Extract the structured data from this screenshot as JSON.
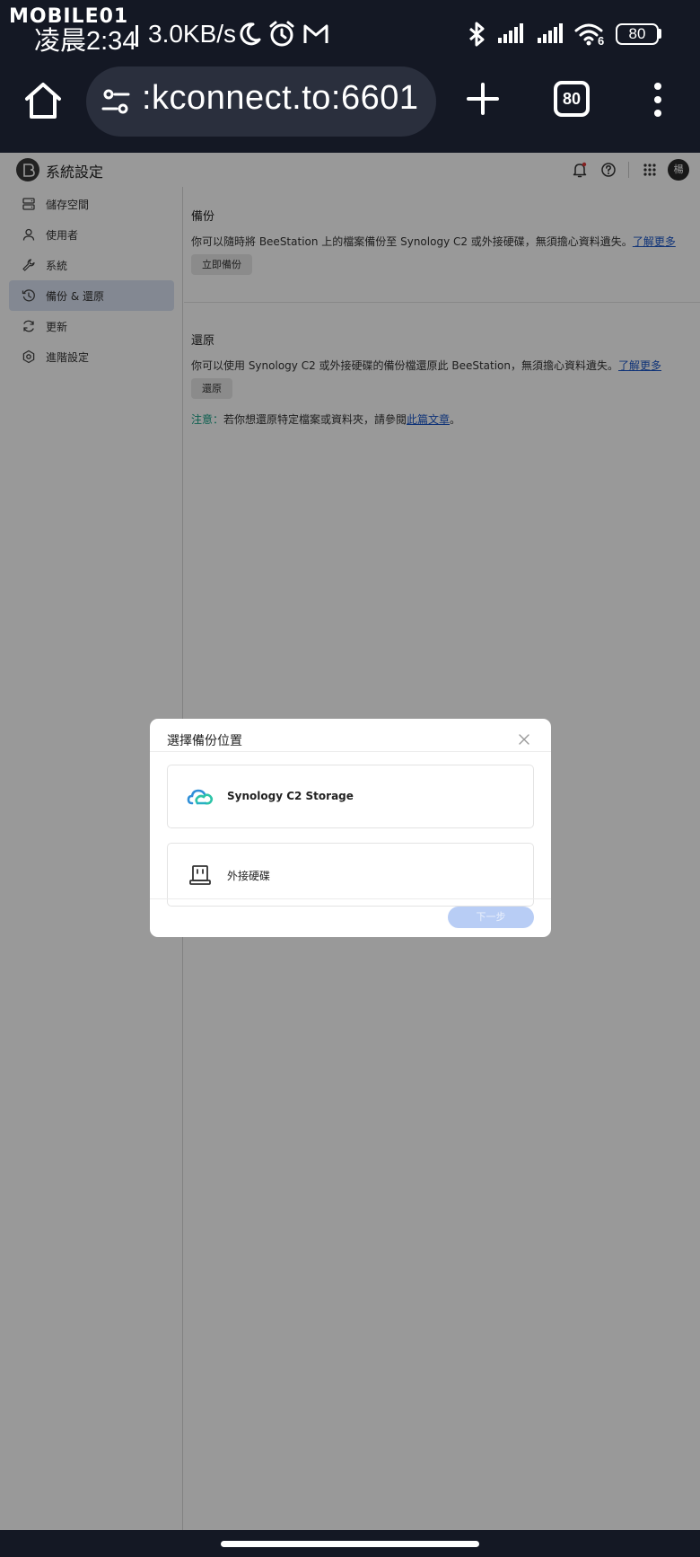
{
  "status_bar": {
    "watermark": "MOBILE01",
    "time": "凌晨2:34",
    "net_speed": "3.0KB/s",
    "battery": "80",
    "wifi_sub": "6",
    "icons": [
      "moon-icon",
      "alarm-icon",
      "gmail-icon",
      "bluetooth-icon",
      "signal-icon",
      "signal-icon",
      "wifi-icon",
      "battery-icon"
    ]
  },
  "browser": {
    "url": ":kconnect.to:6601",
    "tab_count": "80",
    "icons": [
      "home-icon",
      "site-settings-icon",
      "new-tab-icon",
      "tabs-icon",
      "more-menu-icon"
    ]
  },
  "app": {
    "title": "系統設定",
    "avatar": "楊",
    "header_icons": [
      "notification-icon",
      "help-icon",
      "apps-grid-icon"
    ]
  },
  "sidebar": {
    "items": [
      {
        "label": "儲存空間",
        "icon": "storage-icon",
        "active": false
      },
      {
        "label": "使用者",
        "icon": "user-icon",
        "active": false
      },
      {
        "label": "系統",
        "icon": "wrench-icon",
        "active": false
      },
      {
        "label": "備份 & 還原",
        "icon": "backup-restore-icon",
        "active": true
      },
      {
        "label": "更新",
        "icon": "update-icon",
        "active": false
      },
      {
        "label": "進階設定",
        "icon": "advanced-settings-icon",
        "active": false
      }
    ]
  },
  "backup": {
    "title": "備份",
    "desc": "你可以隨時將 BeeStation 上的檔案備份至 Synology C2 或外接硬碟，無須擔心資料遺失。",
    "link": "了解更多",
    "button": "立即備份"
  },
  "restore": {
    "title": "還原",
    "desc": "你可以使用 Synology C2 或外接硬碟的備份檔還原此 BeeStation，無須擔心資料遺失。",
    "link": "了解更多",
    "button": "還原",
    "note_label": "注意：",
    "note_text": "若你想還原特定檔案或資料夾，請參閱",
    "note_link": "此篇文章",
    "note_end": "。"
  },
  "modal": {
    "title": "選擇備份位置",
    "options": [
      {
        "label": "Synology C2 Storage",
        "icon": "c2-cloud-icon"
      },
      {
        "label": "外接硬碟",
        "icon": "external-drive-icon"
      }
    ],
    "next_button": "下一步"
  },
  "colors": {
    "accent": "#1a56c9",
    "active_nav": "#dbe3f3",
    "note": "#16a085",
    "next_disabled": "#b8cdf5",
    "system_bar": "#141824"
  }
}
